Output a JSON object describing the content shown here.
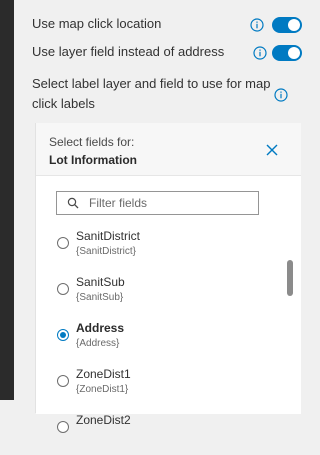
{
  "settings": {
    "rows": [
      {
        "label": "Use map click location",
        "info_icon": "info-icon",
        "toggle_on": true
      },
      {
        "label": "Use layer field instead of address",
        "info_icon": "info-icon",
        "toggle_on": true
      },
      {
        "label_line1": "Select label layer and field to use for map",
        "label_line2": "click labels",
        "info_icon": "info-icon"
      }
    ],
    "accent_color": "#007ac2"
  },
  "field_panel": {
    "subtitle": "Select fields for:",
    "title": "Lot Information",
    "close_icon": "close-icon",
    "filter": {
      "placeholder": "Filter fields",
      "value": "",
      "icon": "search-icon"
    },
    "fields": [
      {
        "name": "SanitDistrict",
        "alias": "{SanitDistrict}",
        "selected": false
      },
      {
        "name": "SanitSub",
        "alias": "{SanitSub}",
        "selected": false
      },
      {
        "name": "Address",
        "alias": "{Address}",
        "selected": true
      },
      {
        "name": "ZoneDist1",
        "alias": "{ZoneDist1}",
        "selected": false
      },
      {
        "name": "ZoneDist2",
        "alias": "",
        "selected": false
      }
    ]
  }
}
